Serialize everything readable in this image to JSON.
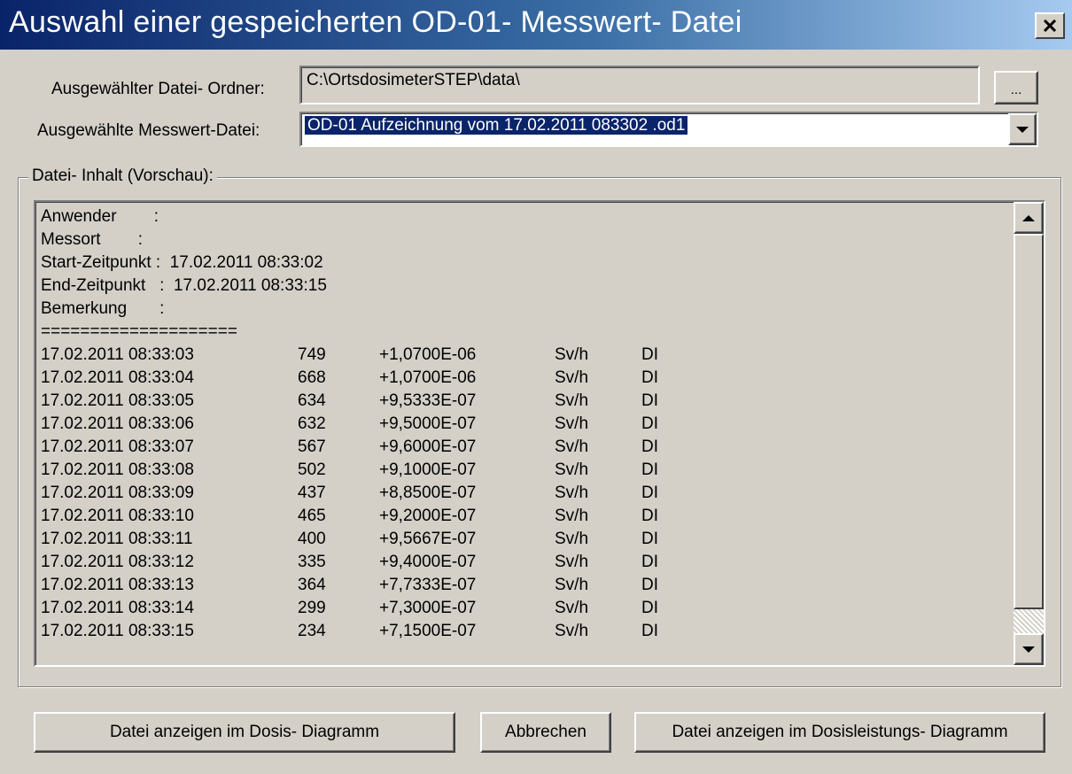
{
  "window": {
    "title": "Auswahl einer gespeicherten OD-01- Messwert- Datei",
    "close_icon": "close-x-icon"
  },
  "folder": {
    "label": "Ausgewählter Datei- Ordner:",
    "value": "C:\\OrtsdosimeterSTEP\\data\\",
    "browse_label": "..."
  },
  "file": {
    "label": "Ausgewählte Messwert-Datei:",
    "value": "OD-01 Aufzeichnung vom  17.02.2011 083302 .od1",
    "dropdown_icon": "chevron-down-icon"
  },
  "preview": {
    "legend": "Datei- Inhalt (Vorschau):",
    "header_lines": [
      "Anwender        :",
      "Messort        :",
      "Start-Zeitpunkt :  17.02.2011 08:33:02",
      "End-Zeitpunkt   :  17.02.2011 08:33:15",
      "Bemerkung       :",
      "===================="
    ],
    "rows": [
      {
        "datetime": "17.02.2011 08:33:03",
        "count": "749",
        "value": "+1,0700E-06",
        "unit": "Sv/h",
        "mode": "DI"
      },
      {
        "datetime": "17.02.2011 08:33:04",
        "count": "668",
        "value": "+1,0700E-06",
        "unit": "Sv/h",
        "mode": "DI"
      },
      {
        "datetime": "17.02.2011 08:33:05",
        "count": "634",
        "value": "+9,5333E-07",
        "unit": "Sv/h",
        "mode": "DI"
      },
      {
        "datetime": "17.02.2011 08:33:06",
        "count": "632",
        "value": "+9,5000E-07",
        "unit": "Sv/h",
        "mode": "DI"
      },
      {
        "datetime": "17.02.2011 08:33:07",
        "count": "567",
        "value": "+9,6000E-07",
        "unit": "Sv/h",
        "mode": "DI"
      },
      {
        "datetime": "17.02.2011 08:33:08",
        "count": "502",
        "value": "+9,1000E-07",
        "unit": "Sv/h",
        "mode": "DI"
      },
      {
        "datetime": "17.02.2011 08:33:09",
        "count": "437",
        "value": "+8,8500E-07",
        "unit": "Sv/h",
        "mode": "DI"
      },
      {
        "datetime": "17.02.2011 08:33:10",
        "count": "465",
        "value": "+9,2000E-07",
        "unit": "Sv/h",
        "mode": "DI"
      },
      {
        "datetime": "17.02.2011 08:33:11",
        "count": "400",
        "value": "+9,5667E-07",
        "unit": "Sv/h",
        "mode": "DI"
      },
      {
        "datetime": "17.02.2011 08:33:12",
        "count": "335",
        "value": "+9,4000E-07",
        "unit": "Sv/h",
        "mode": "DI"
      },
      {
        "datetime": "17.02.2011 08:33:13",
        "count": "364",
        "value": "+7,7333E-07",
        "unit": "Sv/h",
        "mode": "DI"
      },
      {
        "datetime": "17.02.2011 08:33:14",
        "count": "299",
        "value": "+7,3000E-07",
        "unit": "Sv/h",
        "mode": "DI"
      },
      {
        "datetime": "17.02.2011 08:33:15",
        "count": "234",
        "value": "+7,1500E-07",
        "unit": "Sv/h",
        "mode": "DI"
      }
    ],
    "scroll_up_icon": "scroll-up-arrow-icon",
    "scroll_down_icon": "scroll-down-arrow-icon"
  },
  "buttons": {
    "dose_chart": "Datei anzeigen im Dosis- Diagramm",
    "cancel": "Abbrechen",
    "dose_rate_chart": "Datei anzeigen im Dosisleistungs- Diagramm"
  },
  "colors": {
    "title_gradient_start": "#0a246a",
    "title_gradient_end": "#a6caf0",
    "dialog_face": "#d4d0c8",
    "selection": "#0a246a"
  }
}
